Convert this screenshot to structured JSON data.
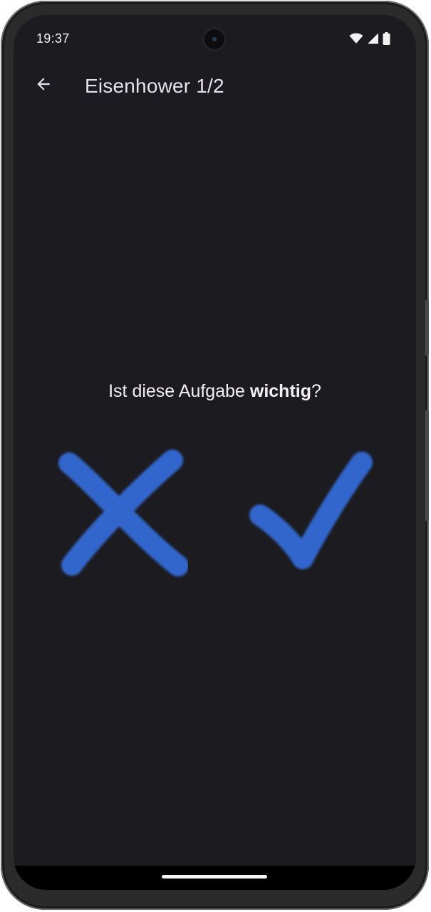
{
  "status_bar": {
    "time": "19:37",
    "icons": [
      "wifi-icon",
      "cellular-signal-icon",
      "battery-icon"
    ]
  },
  "app_bar": {
    "back_icon": "arrow-left-icon",
    "title": "Eisenhower 1/2"
  },
  "question": {
    "prefix": "Ist diese Aufgabe ",
    "emphasis": "wichtig",
    "suffix": "?"
  },
  "answers": {
    "no_icon": "cross-icon",
    "yes_icon": "checkmark-icon",
    "color": "#3366cc"
  },
  "colors": {
    "background": "#1c1b20",
    "text": "#ebe8ee",
    "accent": "#3366cc"
  }
}
